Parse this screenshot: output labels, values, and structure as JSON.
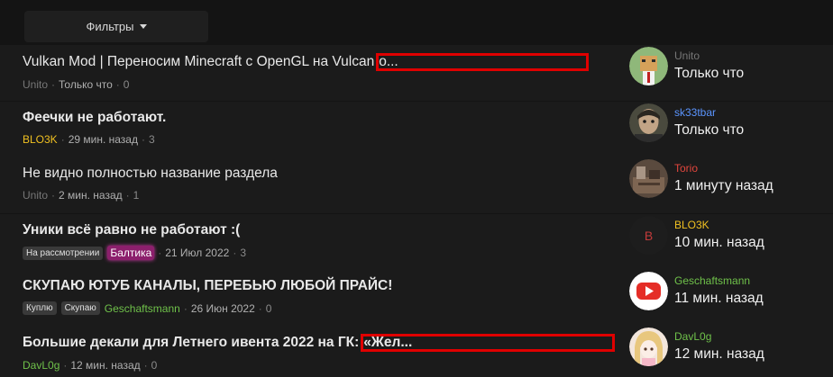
{
  "filter": {
    "label": "Фильтры"
  },
  "threads": [
    {
      "title": "Vulkan Mod | Переносим Minecraft с OpenGL на Vulcan",
      "title_suffix": "о...",
      "author": "Unito",
      "date": "Только что",
      "replies": "0",
      "last_user": "Unito",
      "last_time": "Только что"
    },
    {
      "title": "Феечки не работают.",
      "author": "BLO3K",
      "date": "29 мин. назад",
      "replies": "3",
      "last_user": "sk33tbar",
      "last_time": "Только что"
    },
    {
      "title": "Не видно полностью название раздела",
      "author": "Unito",
      "date": "2 мин. назад",
      "replies": "1",
      "last_user": "Torio",
      "last_time": "1 минуту назад"
    },
    {
      "title": "Уники всё равно не работают :(",
      "prefixes": [
        "На рассмотрении"
      ],
      "author": "Балтика",
      "date": "21 Июл 2022",
      "replies": "3",
      "last_user": "BLO3K",
      "last_user_avatar_letter": "B",
      "last_time": "10 мин. назад"
    },
    {
      "title": "СКУПАЮ ЮТУБ КАНАЛЫ, ПЕРЕБЬЮ ЛЮБОЙ ПРАЙС!",
      "prefixes": [
        "Куплю",
        "Скупаю"
      ],
      "author": "Geschaftsmann",
      "date": "26 Июн 2022",
      "replies": "0",
      "last_user": "Geschaftsmann",
      "last_time": "11 мин. назад"
    },
    {
      "title": "Большие декали для Летнего ивента 2022 на ГК:",
      "title_suffix": "«Жел...",
      "author": "DavL0g",
      "date": "12 мин. назад",
      "replies": "0",
      "last_user": "DavL0g",
      "last_time": "12 мин. назад"
    }
  ]
}
